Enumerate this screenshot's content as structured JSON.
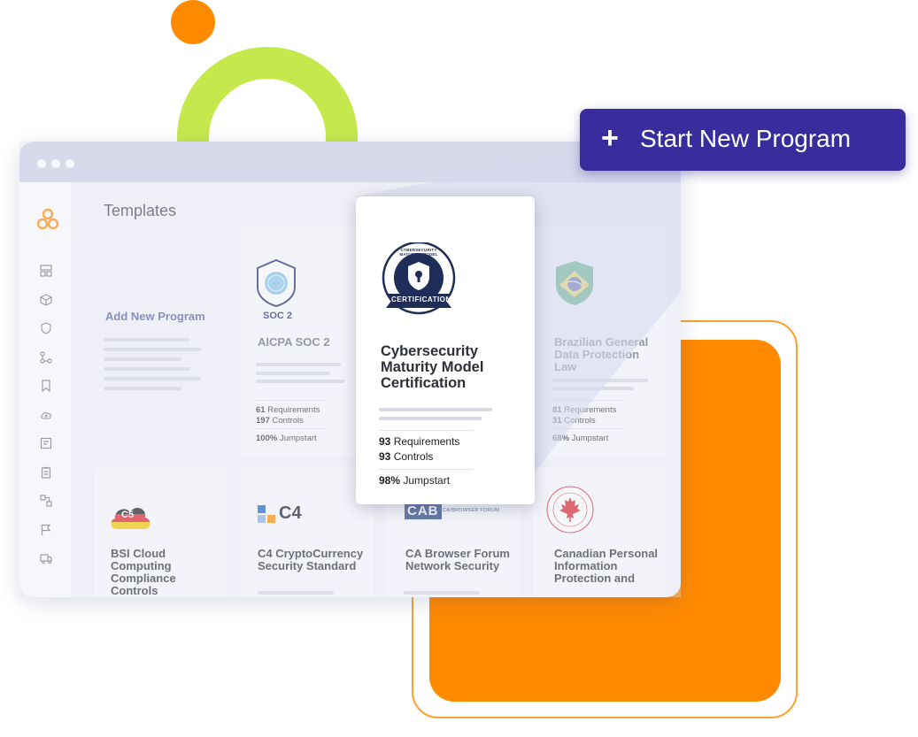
{
  "cta": {
    "label": "Start New Program",
    "icon": "plus-icon"
  },
  "page": {
    "title": "Templates"
  },
  "sidebar": {
    "logo": "app-logo",
    "icons": [
      "dashboard-icon",
      "box-icon",
      "shield-icon",
      "workflow-icon",
      "bookmark-icon",
      "cloud-upload-icon",
      "report-icon",
      "clipboard-icon",
      "integration-icon",
      "flag-icon",
      "truck-icon"
    ]
  },
  "add_new": {
    "label": "Add New Program"
  },
  "templates": [
    {
      "name": "AICPA SOC 2",
      "badge": "SOC 2",
      "requirements": "61",
      "controls": "197",
      "jumpstart": "100%"
    },
    {
      "name": "Brazilian General Data Protection Law",
      "requirements": "81",
      "controls": "31",
      "jumpstart": "68%"
    },
    {
      "name": "BSI Cloud Computing Compliance Controls",
      "badge": "C5"
    },
    {
      "name": "C4 CryptoCurrency Security Standard",
      "badge": "C4"
    },
    {
      "name": "CA Browser Forum Network Security",
      "badge": "CAB",
      "badge_sub": "CA/BROWSER FORUM"
    },
    {
      "name": "Canadian Personal Information Protection and"
    }
  ],
  "featured": {
    "name": "Cybersecurity Maturity Model Certification",
    "badge_ring_text": "CYBERSECURITY MATURITY MODEL",
    "badge_ribbon": "CERTIFICATION",
    "requirements": "93",
    "controls": "93",
    "jumpstart": "98%"
  },
  "labels": {
    "requirements": "Requirements",
    "controls": "Controls",
    "jumpstart": "Jumpstart"
  },
  "colors": {
    "brand": "#3a2c9d",
    "accent": "#ff8a00",
    "lime": "#c5e84d"
  }
}
